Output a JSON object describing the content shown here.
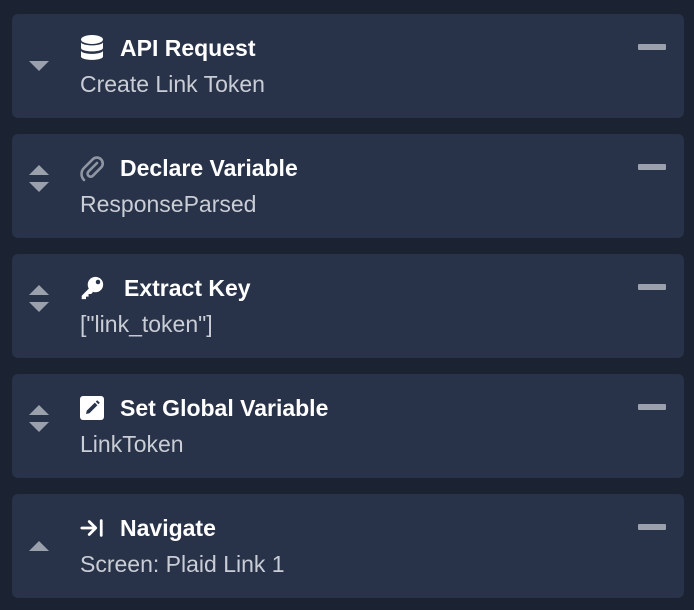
{
  "blocks": [
    {
      "title": "API Request",
      "subtitle": "Create Link Token",
      "icon": "database-icon",
      "can_move_up": false,
      "can_move_down": true
    },
    {
      "title": "Declare Variable",
      "subtitle": "ResponseParsed",
      "icon": "paperclip-icon",
      "can_move_up": true,
      "can_move_down": true
    },
    {
      "title": "Extract Key",
      "subtitle": "[\"link_token\"]",
      "icon": "key-icon",
      "can_move_up": true,
      "can_move_down": true
    },
    {
      "title": "Set Global Variable",
      "subtitle": "LinkToken",
      "icon": "edit-icon",
      "can_move_up": true,
      "can_move_down": true
    },
    {
      "title": "Navigate",
      "subtitle": "Screen: Plaid Link 1",
      "icon": "arrow-right-to-bar-icon",
      "can_move_up": true,
      "can_move_down": false
    }
  ],
  "colors": {
    "background": "#1b2232",
    "card": "#283248",
    "title": "#ffffff",
    "subtitle": "#c9cdd6",
    "control": "#9aa1ad"
  }
}
